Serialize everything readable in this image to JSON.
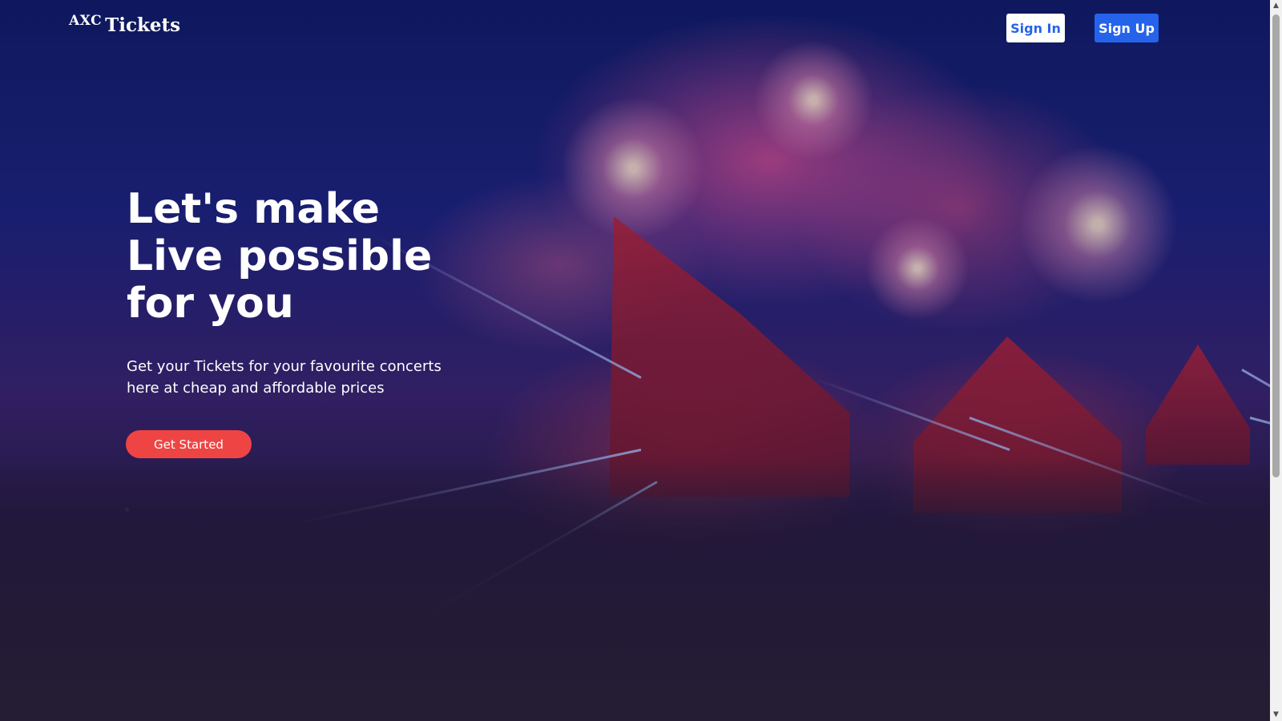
{
  "header": {
    "logo_prefix": "AXC",
    "logo_main": "Tickets",
    "sign_in_label": "Sign In",
    "sign_up_label": "Sign Up"
  },
  "hero": {
    "title": "Let's make Live possible for you",
    "subtitle": "Get your Tickets for your favourite concerts here at cheap and affordable prices",
    "cta_label": "Get Started",
    "background": "concert-stage-fireworks-crowd-image"
  },
  "colors": {
    "primary": "#2563eb",
    "cta": "#ef4444",
    "text_on_dark": "#ffffff"
  },
  "scrollbar": {
    "up_icon": "triangle-up-icon",
    "down_icon": "triangle-down-icon"
  }
}
